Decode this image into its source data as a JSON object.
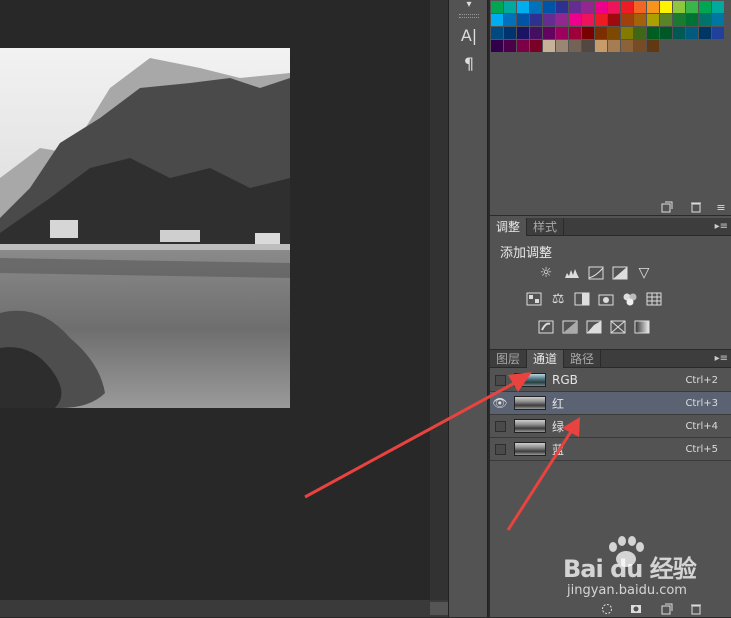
{
  "toolstrip": {
    "tools": [
      {
        "icon": "character-panel-icon",
        "glyph": "A|"
      },
      {
        "icon": "paragraph-panel-icon",
        "glyph": "¶"
      }
    ]
  },
  "swatches": {
    "rows": [
      [
        "#00a651",
        "#00a99d",
        "#00aeef",
        "#0072bc",
        "#0054a6",
        "#2e3192",
        "#662d91",
        "#92278f",
        "#ec008c",
        "#ed145b",
        "#ed1c24",
        "#f26522",
        "#f7941d",
        "#fff200",
        "#8dc63f",
        "#39b54a",
        "#00a651",
        "#00a99d"
      ],
      [
        "#00aeef",
        "#0072bc",
        "#0054a6",
        "#2e3192",
        "#662d91",
        "#92278f",
        "#ec008c",
        "#ed145b",
        "#ed1c24",
        "#9e0b0f",
        "#a0410d",
        "#a36209",
        "#aba000",
        "#598527",
        "#197b30",
        "#007236",
        "#00746b",
        "#0076a3"
      ],
      [
        "#004a80",
        "#003471",
        "#1b1464",
        "#440e62",
        "#630460",
        "#9e005d",
        "#9e0039",
        "#790000",
        "#7b2e00",
        "#7d4900",
        "#827b00",
        "#406618",
        "#005e20",
        "#005826",
        "#005952",
        "#005b7f",
        "#003663",
        "#21409a"
      ],
      [
        "#32004b",
        "#4b0049",
        "#7b0046",
        "#7a0026",
        "#c7b299",
        "#998675",
        "#736357",
        "#534741",
        "#c69c6d",
        "#a67c52",
        "#8c6239",
        "#754c24",
        "#603913"
      ]
    ]
  },
  "adjustments": {
    "tabs": [
      "调整",
      "样式"
    ],
    "active_tab": 0,
    "title": "添加调整",
    "row1": [
      "brightness-contrast-icon",
      "levels-icon",
      "curves-icon",
      "exposure-icon",
      "vibrance-icon"
    ],
    "row2": [
      "hue-saturation-icon",
      "color-balance-icon",
      "black-white-icon",
      "photo-filter-icon",
      "channel-mixer-icon",
      "color-lookup-icon"
    ],
    "row3": [
      "invert-icon",
      "posterize-icon",
      "threshold-icon",
      "selective-color-icon",
      "gradient-map-icon"
    ]
  },
  "channels": {
    "tabs": [
      "图层",
      "通道",
      "路径"
    ],
    "active_tab": 1,
    "rows": [
      {
        "name": "RGB",
        "shortcut": "Ctrl+2",
        "visible": false,
        "selected": false,
        "thumb": "rgb"
      },
      {
        "name": "红",
        "shortcut": "Ctrl+3",
        "visible": true,
        "selected": true,
        "thumb": "gray"
      },
      {
        "name": "绿",
        "shortcut": "Ctrl+4",
        "visible": false,
        "selected": false,
        "thumb": "gray"
      },
      {
        "name": "蓝",
        "shortcut": "Ctrl+5",
        "visible": false,
        "selected": false,
        "thumb": "gray"
      }
    ]
  },
  "watermark": {
    "brand": "Bai du 经验",
    "url": "jingyan.baidu.com"
  },
  "colors": {
    "arrow": "#e8433e",
    "selected_row": "#5b6272"
  }
}
